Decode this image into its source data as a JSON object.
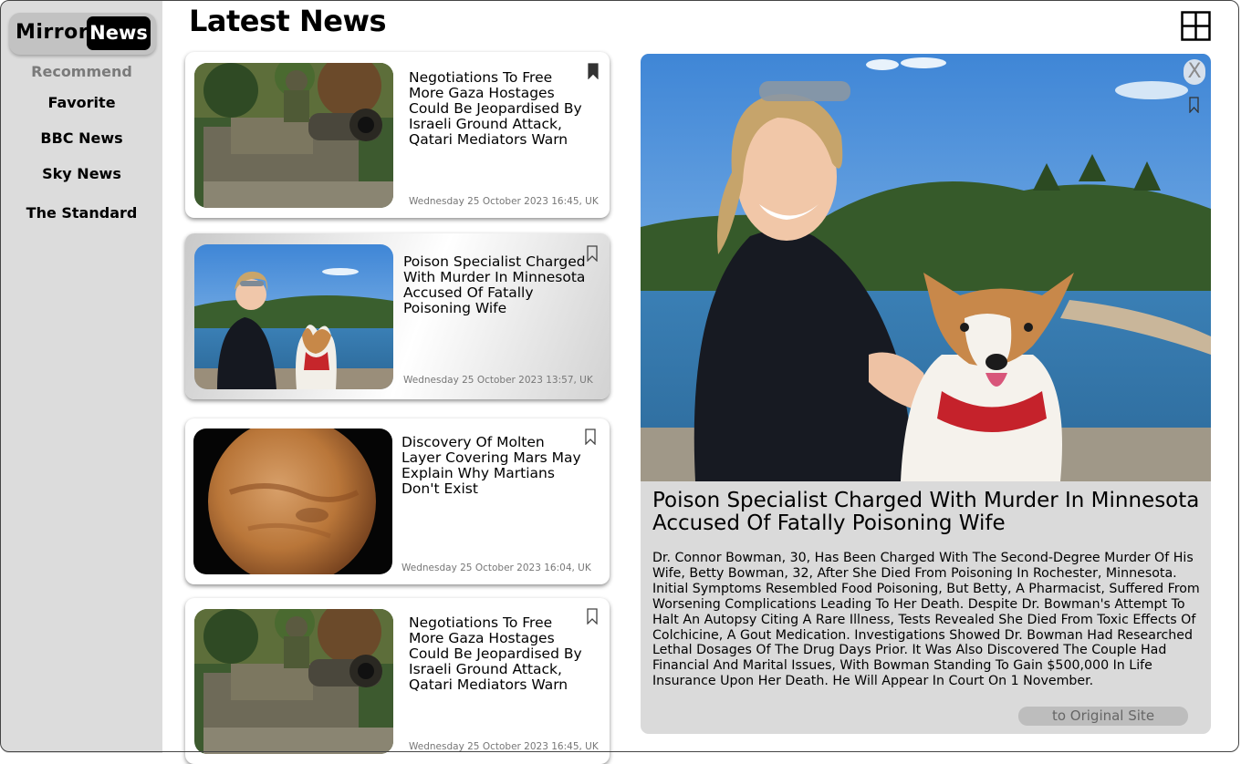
{
  "logo": {
    "mirror": "Mirror",
    "news": "News"
  },
  "sidebar": {
    "items": [
      {
        "label": "Recommend",
        "color": "#7a7a7a"
      },
      {
        "label": "Favorite",
        "color": "#000000"
      },
      {
        "label": "BBC News",
        "color": "#000000"
      },
      {
        "label": "Sky News",
        "color": "#000000"
      },
      {
        "label": "The Standard",
        "color": "#000000"
      }
    ]
  },
  "header": {
    "title": "Latest News",
    "grid_icon": "grid-icon"
  },
  "cards": [
    {
      "title": "Negotiations To Free More Gaza Hostages Could Be Jeopardised By Israeli Ground Attack, Qatari Mediators Warn",
      "date": "Wednesday 25 October 2023 16:45, UK",
      "bookmarked": true,
      "image": "soldier-on-tank"
    },
    {
      "title": "Poison Specialist Charged With Murder In Minnesota Accused Of Fatally Poisoning Wife",
      "date": "Wednesday 25 October 2023 13:57, UK",
      "bookmarked": false,
      "image": "woman-with-corgi"
    },
    {
      "title": "Discovery Of Molten Layer Covering Mars May Explain Why Martians Don't Exist",
      "date": "Wednesday 25 October 2023 16:04, UK",
      "bookmarked": false,
      "image": "planet-mars"
    },
    {
      "title": "Negotiations To Free More Gaza Hostages Could Be Jeopardised By Israeli Ground Attack, Qatari Mediators Warn",
      "date": "Wednesday 25 October 2023 16:45, UK",
      "bookmarked": false,
      "image": "soldier-on-tank"
    }
  ],
  "detail": {
    "close_label": "X",
    "title": "Poison Specialist Charged With Murder In Minnesota Accused Of Fatally Poisoning Wife",
    "body": "Dr. Connor Bowman, 30, Has Been Charged With The Second-Degree Murder Of His Wife, Betty Bowman, 32, After She Died From Poisoning In Rochester, Minnesota. Initial Symptoms Resembled Food Poisoning, But Betty, A Pharmacist, Suffered From Worsening Complications Leading To Her Death. Despite Dr. Bowman's Attempt To Halt An Autopsy Citing A Rare Illness, Tests Revealed She Died From Toxic Effects Of Colchicine, A Gout Medication. Investigations Showed Dr. Bowman Had Researched Lethal Dosages Of The Drug Days Prior. It Was Also Discovered The Couple Had Financial And Marital Issues, With Bowman Standing To Gain $500,000 In Life Insurance Upon Her Death. He Will Appear In Court On 1 November.",
    "original_site_label": "to Original Site",
    "image": "woman-with-corgi"
  }
}
